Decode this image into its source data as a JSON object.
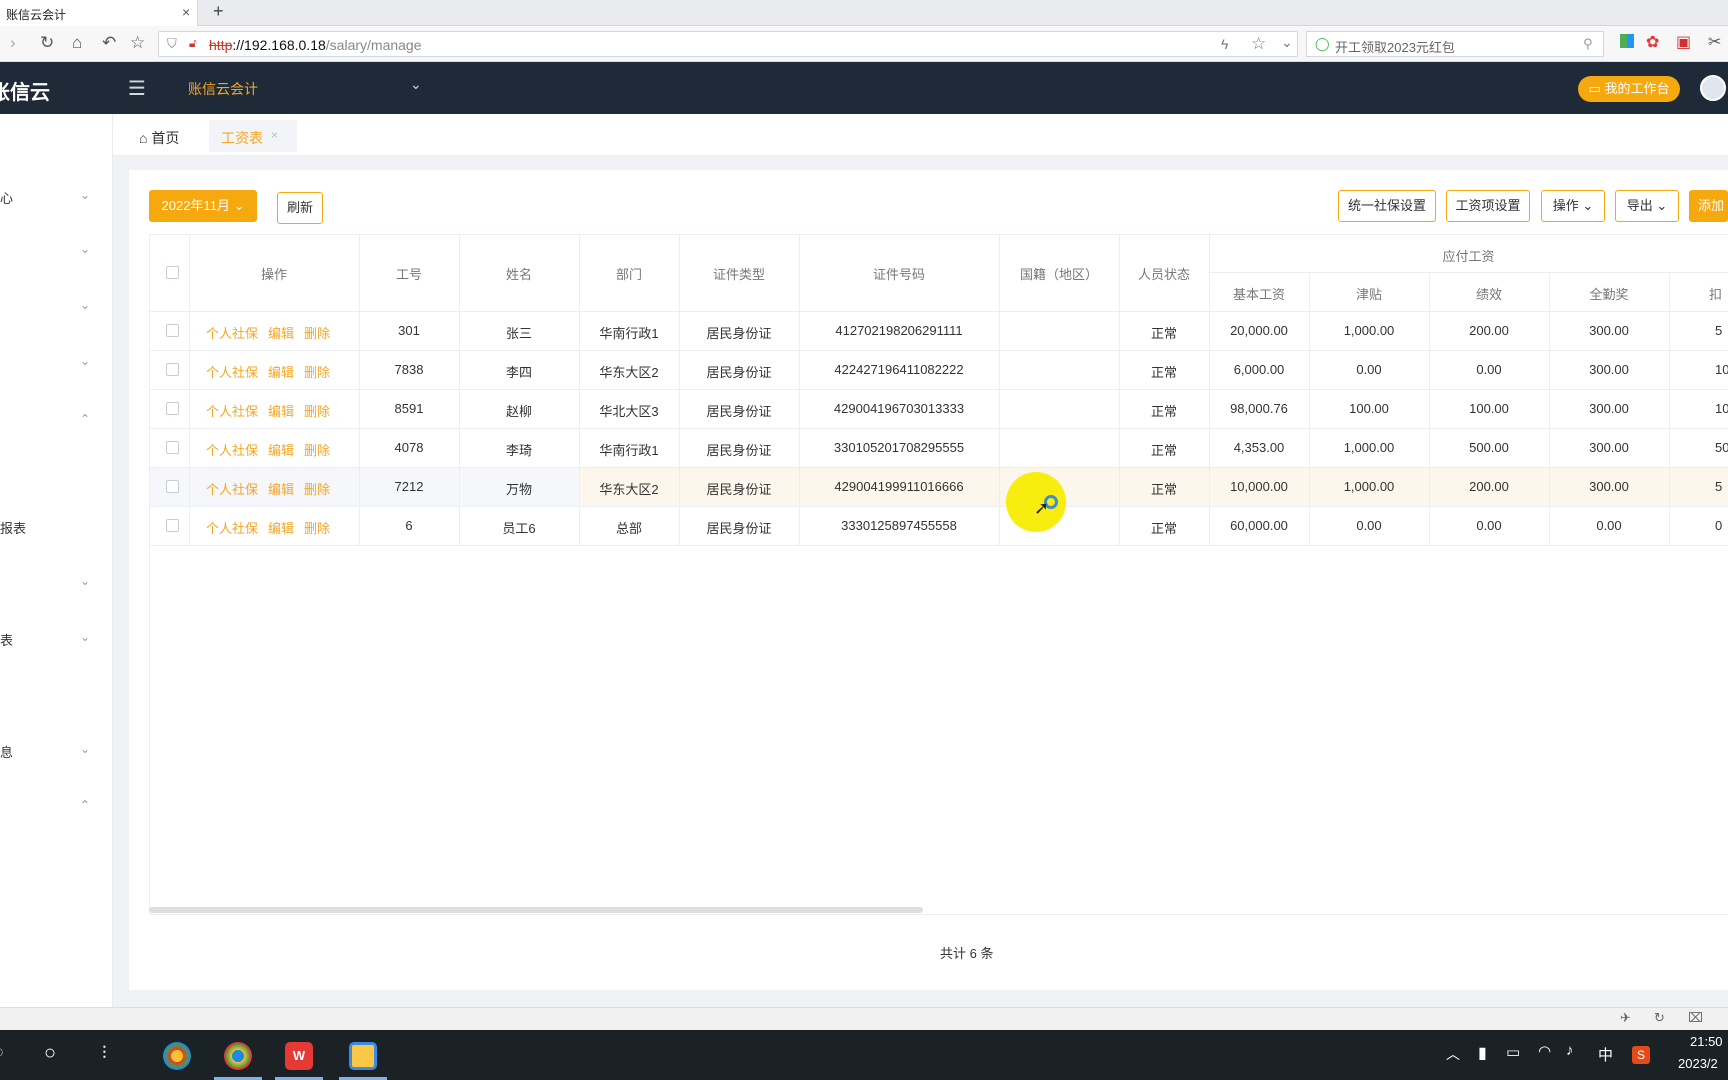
{
  "browser": {
    "tab_title": "账信云会计",
    "tab_close": "×",
    "new_tab": "+",
    "url_protocol": "http",
    "url_host": "://192.168.0.18",
    "url_path": "/salary/manage",
    "search_placeholder": "开工领取2023元红包"
  },
  "header": {
    "logo": "账信云",
    "company": "账信云会计",
    "workbench_button": "我的工作台"
  },
  "sidebar": {
    "items": [
      {
        "label": "心",
        "caret": "⌄"
      },
      {
        "label": "",
        "caret": "⌄"
      },
      {
        "label": "",
        "caret": "⌄"
      },
      {
        "label": "",
        "caret": "⌄"
      },
      {
        "label": "",
        "caret": "⌃"
      },
      {
        "label": "报表",
        "caret": ""
      },
      {
        "label": "",
        "caret": "⌄"
      },
      {
        "label": "表",
        "caret": "⌄"
      },
      {
        "label": "息",
        "caret": "⌄"
      },
      {
        "label": "",
        "caret": "⌃"
      }
    ]
  },
  "breadcrumb": {
    "home": "首页",
    "active_tab": "工资表",
    "active_tab_close": "×"
  },
  "toolbar": {
    "period": "2022年11月",
    "refresh": "刷新",
    "social_security": "统一社保设置",
    "salary_items": "工资项设置",
    "operation": "操作",
    "export": "导出",
    "add": "添加员工"
  },
  "table": {
    "group_header": "应付工资",
    "columns": [
      "操作",
      "工号",
      "姓名",
      "部门",
      "证件类型",
      "证件号码",
      "国籍（地区）",
      "人员状态",
      "基本工资",
      "津贴",
      "绩效",
      "全勤奖",
      "扣"
    ],
    "op_links": [
      "个人社保",
      "编辑",
      "删除"
    ],
    "rows": [
      {
        "id": "301",
        "name": "张三",
        "dept": "华南行政1",
        "idtype": "居民身份证",
        "idno": "412702198206291111",
        "nation": "",
        "status": "正常",
        "base": "20,000.00",
        "allow": "1,000.00",
        "perf": "200.00",
        "attend": "300.00",
        "ded": "5"
      },
      {
        "id": "7838",
        "name": "李四",
        "dept": "华东大区2",
        "idtype": "居民身份证",
        "idno": "422427196411082222",
        "nation": "",
        "status": "正常",
        "base": "6,000.00",
        "allow": "0.00",
        "perf": "0.00",
        "attend": "300.00",
        "ded": "10"
      },
      {
        "id": "8591",
        "name": "赵柳",
        "dept": "华北大区3",
        "idtype": "居民身份证",
        "idno": "429004196703013333",
        "nation": "",
        "status": "正常",
        "base": "98,000.76",
        "allow": "100.00",
        "perf": "100.00",
        "attend": "300.00",
        "ded": "10"
      },
      {
        "id": "4078",
        "name": "李琦",
        "dept": "华南行政1",
        "idtype": "居民身份证",
        "idno": "330105201708295555",
        "nation": "",
        "status": "正常",
        "base": "4,353.00",
        "allow": "1,000.00",
        "perf": "500.00",
        "attend": "300.00",
        "ded": "50"
      },
      {
        "id": "7212",
        "name": "万物",
        "dept": "华东大区2",
        "idtype": "居民身份证",
        "idno": "429004199911016666",
        "nation": "",
        "status": "正常",
        "base": "10,000.00",
        "allow": "1,000.00",
        "perf": "200.00",
        "attend": "300.00",
        "ded": "5"
      },
      {
        "id": "6",
        "name": "员工6",
        "dept": "总部",
        "idtype": "居民身份证",
        "idno": "3330125897455558",
        "nation": "",
        "status": "正常",
        "base": "60,000.00",
        "allow": "0.00",
        "perf": "0.00",
        "attend": "0.00",
        "ded": "0"
      }
    ]
  },
  "footer": {
    "total": "共计 6 条"
  },
  "taskbar": {
    "ime": "中",
    "time": "21:50",
    "date": "2023/2"
  },
  "colors": {
    "accent": "#f5a90f",
    "header_bg": "#1f2a38",
    "highlight_row": "#fdf6ec"
  }
}
